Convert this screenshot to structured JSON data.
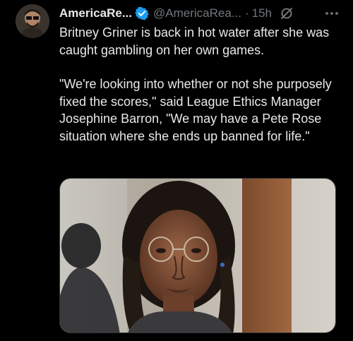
{
  "tweet": {
    "display_name": "AmericaRe...",
    "handle": "@AmericaRea...",
    "separator": "·",
    "time": "15h",
    "paragraph1": "Britney Griner is back in hot water after she was caught gambling on her own games.",
    "paragraph2": "\"We're looking into whether or not she purposely fixed the scores,\" said League Ethics Manager Josephine Barron, \"We may have a Pete Rose situation where she ends up banned for life.\"",
    "verified_badge_color": "#1d9bf0",
    "icons": {
      "verified": "verified-badge-icon",
      "grok": "grok-icon",
      "more": "more-options-icon"
    }
  },
  "colors": {
    "background": "#000000",
    "text_primary": "#e7e9ea",
    "text_secondary": "#71767b"
  }
}
